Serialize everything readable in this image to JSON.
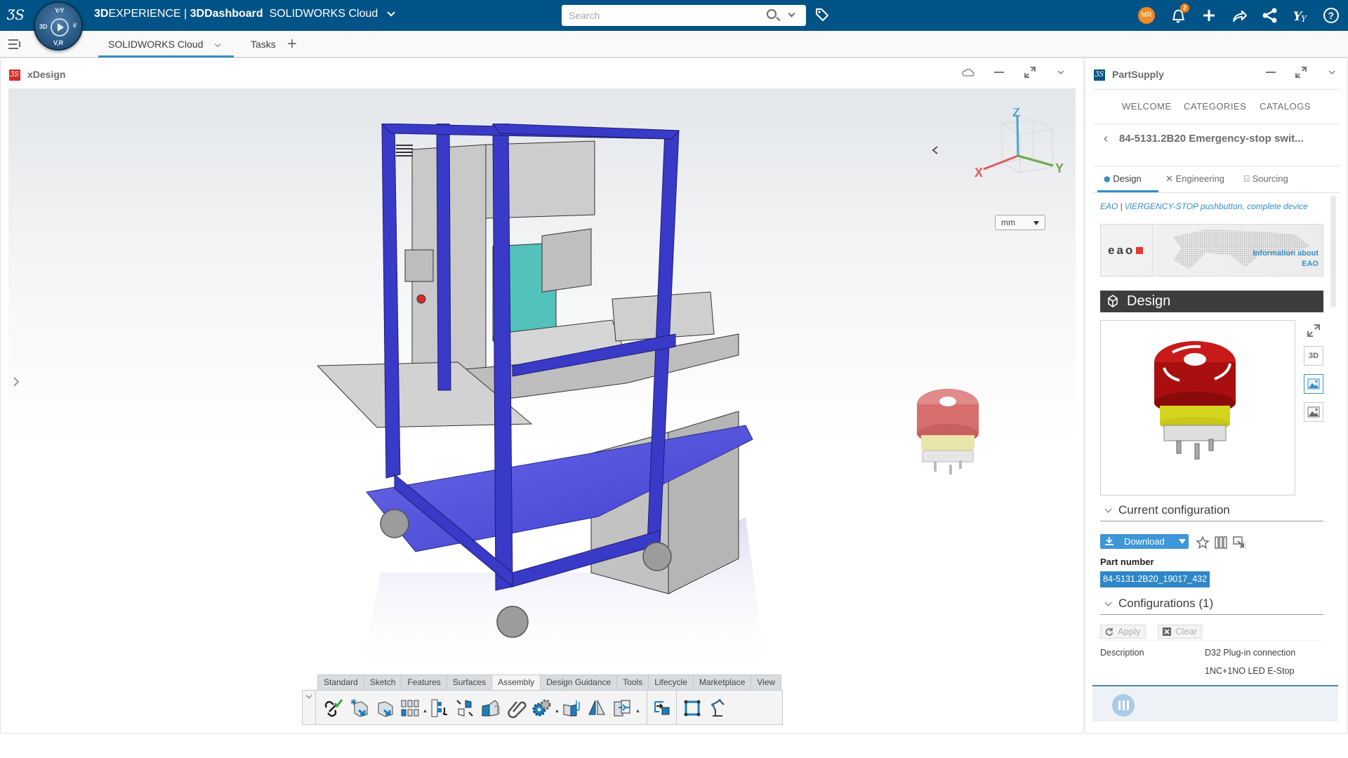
{
  "topbar": {
    "brand_bold": "3D",
    "brand_rest": "EXPERIENCE | ",
    "dashboard_bold": "3DDashboard",
    "dashboard_name": "SOLIDWORKS Cloud",
    "compass_labels": {
      "top": "Y⁄Y",
      "left": "3D",
      "right": "i/",
      "bottom": "V,R"
    },
    "search": {
      "placeholder": "Search",
      "value": ""
    },
    "user_initials": "MR",
    "notifications_count": "2",
    "icons": [
      "tag-icon",
      "avatar",
      "notifications-icon",
      "add-icon",
      "share-icon",
      "social-share-icon",
      "compass-apps-icon",
      "help-icon"
    ],
    "colors": {
      "bar": "#005386",
      "avatar": "#f08a24",
      "badge": "#e87d16",
      "accent": "#368ec4"
    }
  },
  "dashboard_tabs": {
    "tabs": [
      {
        "label": "SOLIDWORKS Cloud",
        "active": true
      },
      {
        "label": "Tasks",
        "active": false
      }
    ]
  },
  "xdesign": {
    "title": "xDesign",
    "units": {
      "selected": "mm"
    },
    "triad": {
      "x": "X",
      "y": "Y",
      "z": "Z"
    },
    "toolbar": {
      "tabs": [
        "Standard",
        "Sketch",
        "Features",
        "Surfaces",
        "Assembly",
        "Design Guidance",
        "Tools",
        "Lifecycle",
        "Marketplace",
        "View"
      ],
      "active_tab": "Assembly",
      "tools": [
        "check-connections-icon",
        "insert-new-component-icon",
        "insert-component-icon",
        "pattern-icon",
        "reorder-structure-icon",
        "explode-icon",
        "component-properties-icon",
        "attach-icon",
        "mechanism-icon",
        "mate-icon",
        "mirror-component-icon",
        "interference-icon",
        "import-component-icon",
        "frame-icon",
        "robot-arm-icon"
      ]
    }
  },
  "partsupply": {
    "title": "PartSupply",
    "nav": [
      "WELCOME",
      "CATEGORIES",
      "CATALOGS"
    ],
    "breadcrumb_title": "84-5131.2B20 Emergency-stop swit...",
    "subtabs": [
      {
        "label": "Design",
        "active": true
      },
      {
        "label": "Engineering",
        "active": false
      },
      {
        "label": "Sourcing",
        "active": false
      }
    ],
    "supplier_link": "EAO",
    "product_link": "\\/IERGENCY-STOP pushbutton, complete device",
    "banner": {
      "logo": "eao",
      "info_line1": "Information about",
      "info_line2": "EAO"
    },
    "design_header": "Design",
    "preview_buttons": [
      "3D",
      "image-active",
      "image"
    ],
    "current_configuration": {
      "header": "Current configuration",
      "download_label": "Download",
      "part_number_label": "Part number",
      "part_number": "84-5131.2B20_19017_432"
    },
    "configurations": {
      "header": "Configurations (1)",
      "apply_label": "Apply",
      "clear_label": "Clear",
      "description_label": "Description",
      "description_values": [
        "D32 Plug-in connection",
        "1NC+1NO LED E-Stop"
      ]
    }
  }
}
